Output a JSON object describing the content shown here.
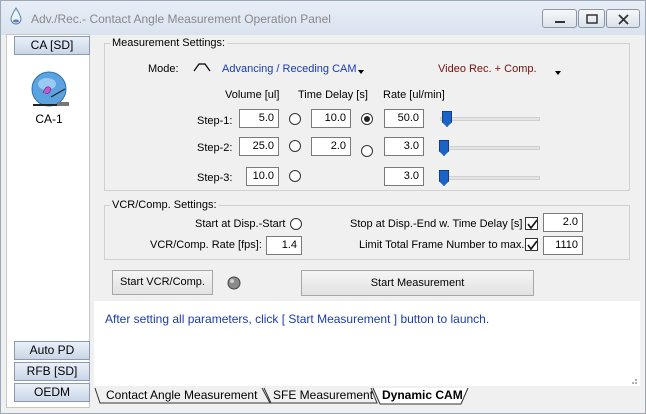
{
  "window": {
    "title": "Adv./Rec.- Contact Angle Measurement Operation Panel"
  },
  "sidebar": {
    "top_button": "CA [SD]",
    "logo_label": "CA-1",
    "bottom_buttons": [
      "Auto PD",
      "RFB [SD]",
      "OEDM"
    ]
  },
  "measurement": {
    "group_title": "Measurement Settings:",
    "mode_label": "Mode:",
    "mode_value": "Advancing / Receding  CAM",
    "video_value": "Video Rec. + Comp.",
    "col_volume": "Volume [ul]",
    "col_delay": "Time Delay [s]",
    "col_rate": "Rate [ul/min]",
    "steps": [
      {
        "label": "Step-1:",
        "volume": "5.0",
        "delay": "10.0",
        "rate": "50.0"
      },
      {
        "label": "Step-2:",
        "volume": "25.0",
        "delay": "2.0",
        "rate": "3.0"
      },
      {
        "label": "Step-3:",
        "volume": "10.0",
        "rate": "3.0"
      }
    ],
    "selected_delay_radio": 0
  },
  "vcr": {
    "group_title": "VCR/Comp. Settings:",
    "start_label": "Start at Disp.-Start",
    "rate_label": "VCR/Comp. Rate [fps]:",
    "rate_value": "1.4",
    "stop_label": "Stop at Disp.-End w. Time Delay [s]",
    "stop_value": "2.0",
    "stop_checked": true,
    "limit_label": "Limit Total Frame Number to max.",
    "limit_value": "1110",
    "limit_checked": true
  },
  "actions": {
    "start_vcr": "Start VCR/Comp.",
    "start_measure": "Start Measurement"
  },
  "status": {
    "message": "After setting all parameters, click [ Start Measurement ] button to launch."
  },
  "tabs": [
    "Contact Angle Measurement",
    "SFE Measurement",
    "Dynamic CAM"
  ],
  "colors": {
    "accent": "#1a3bb3",
    "slider": "#1b63c6",
    "video_text": "#7a1010"
  }
}
